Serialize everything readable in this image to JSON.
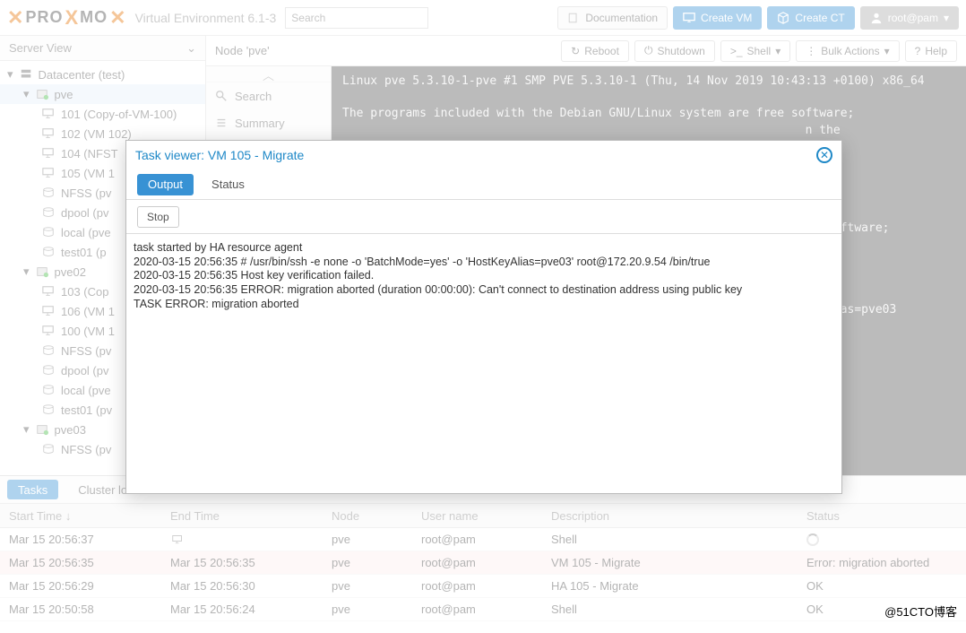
{
  "header": {
    "brand1": "PRO",
    "brand_x": "X",
    "brand2": "MO",
    "version": "Virtual Environment 6.1-3",
    "search_placeholder": "Search",
    "doc": "Documentation",
    "create_vm": "Create VM",
    "create_ct": "Create CT",
    "user": "root@pam"
  },
  "sidebar": {
    "title": "Server View",
    "dc": "Datacenter (test)",
    "nodes": [
      {
        "name": "pve",
        "items": [
          "101 (Copy-of-VM-100)",
          "102 (VM 102)",
          "104 (NFST",
          "105 (VM 1",
          "NFSS (pv",
          "dpool (pv",
          "local (pve",
          "test01 (p"
        ]
      },
      {
        "name": "pve02",
        "items": [
          "103 (Cop",
          "106 (VM 1",
          "100 (VM 1",
          "NFSS (pv",
          "dpool (pv",
          "local (pve",
          "test01 (pv"
        ]
      },
      {
        "name": "pve03",
        "items": [
          "NFSS (pv"
        ]
      }
    ]
  },
  "content": {
    "title": "Node 'pve'",
    "buttons": {
      "reboot": "Reboot",
      "shutdown": "Shutdown",
      "shell": "Shell",
      "bulk": "Bulk Actions",
      "help": "Help"
    },
    "submenu": {
      "search": "Search",
      "summary": "Summary"
    },
    "console": "Linux pve 5.3.10-1-pve #1 SMP PVE 5.3.10-1 (Thu, 14 Nov 2019 10:43:13 +0100) x86_64\n\nThe programs included with the Debian GNU/Linux system are free software;\n                                                                  n the\n\n                                                                  tent\n\n                                                         9 10:43:13 +0\n\n                                                                  ee software;\n                                                                  n the\n\n                                                                  tent\n\n                                                                  eyAlias=pve03"
  },
  "tasks": {
    "tab_tasks": "Tasks",
    "tab_cluster": "Cluster lo",
    "head": {
      "start": "Start Time ↓",
      "end": "End Time",
      "node": "Node",
      "user": "User name",
      "desc": "Description",
      "status": "Status"
    },
    "rows": [
      {
        "start": "Mar 15 20:56:37",
        "end": "",
        "node": "pve",
        "user": "root@pam",
        "desc": "Shell",
        "status": "",
        "spin": true
      },
      {
        "start": "Mar 15 20:56:35",
        "end": "Mar 15 20:56:35",
        "node": "pve",
        "user": "root@pam",
        "desc": "VM 105 - Migrate",
        "status": "Error: migration aborted",
        "err": true
      },
      {
        "start": "Mar 15 20:56:29",
        "end": "Mar 15 20:56:30",
        "node": "pve",
        "user": "root@pam",
        "desc": "HA 105 - Migrate",
        "status": "OK"
      },
      {
        "start": "Mar 15 20:50:58",
        "end": "Mar 15 20:56:24",
        "node": "pve",
        "user": "root@pam",
        "desc": "Shell",
        "status": "OK"
      }
    ]
  },
  "dialog": {
    "title": "Task viewer: VM 105 - Migrate",
    "tab_output": "Output",
    "tab_status": "Status",
    "stop": "Stop",
    "log": "task started by HA resource agent\n2020-03-15 20:56:35 # /usr/bin/ssh -e none -o 'BatchMode=yes' -o 'HostKeyAlias=pve03' root@172.20.9.54 /bin/true\n2020-03-15 20:56:35 Host key verification failed.\n2020-03-15 20:56:35 ERROR: migration aborted (duration 00:00:00): Can't connect to destination address using public key\nTASK ERROR: migration aborted"
  },
  "watermark": "@51CTO博客"
}
